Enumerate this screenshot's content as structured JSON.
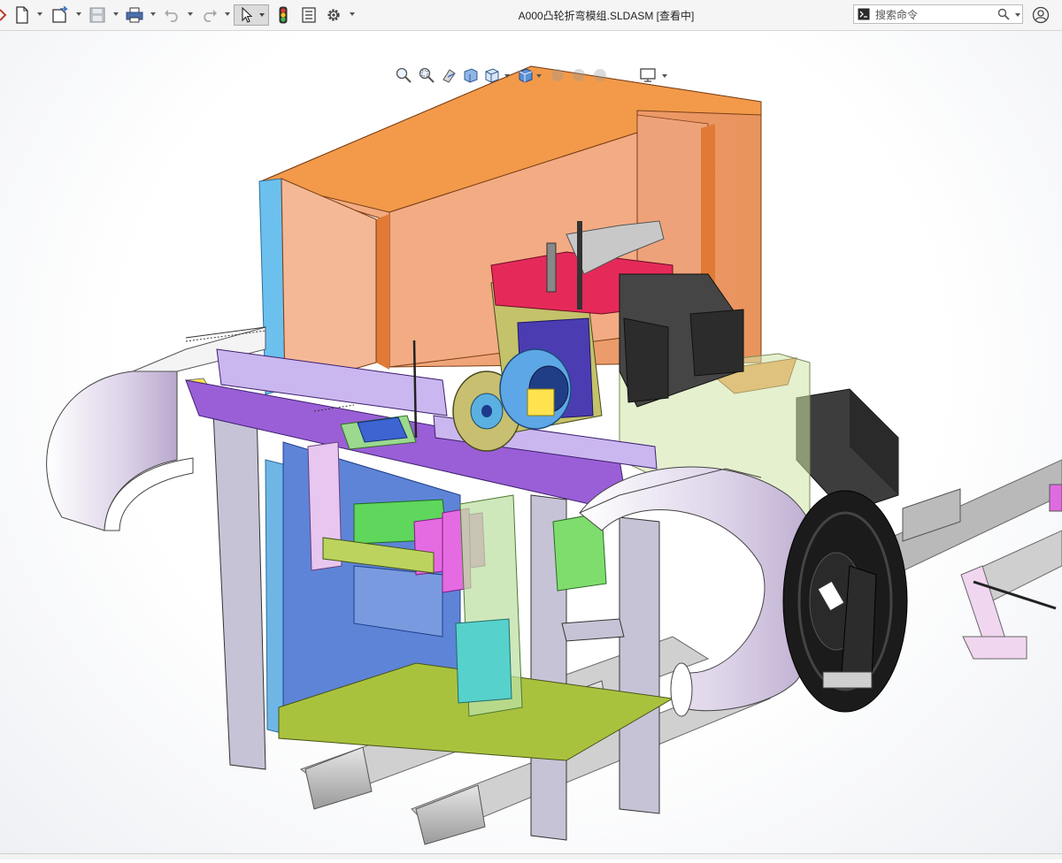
{
  "window": {
    "title": "A000凸轮折弯模组.SLDASM [查看中]"
  },
  "toolbar": {
    "items": [
      {
        "name": "solidworks-menu-icon"
      },
      {
        "name": "new-document-icon"
      },
      {
        "name": "open-document-icon"
      },
      {
        "name": "save-icon"
      },
      {
        "name": "print-icon"
      },
      {
        "name": "undo-icon"
      },
      {
        "name": "redo-icon"
      },
      {
        "name": "select-pointer-icon"
      },
      {
        "name": "rebuild-traffic-light-icon"
      },
      {
        "name": "file-properties-icon"
      },
      {
        "name": "options-gear-icon"
      }
    ]
  },
  "search": {
    "placeholder": "搜索命令"
  },
  "heads_up_toolbar": {
    "items": [
      "zoom-to-fit-icon",
      "zoom-to-area-icon",
      "previous-view-icon",
      "section-view-icon",
      "view-orientation-icon",
      "display-style-icon",
      "hide-show-items-icon",
      "edit-appearance-icon",
      "apply-scene-icon",
      "view-settings-icon"
    ]
  },
  "colors": {
    "accent_orange": "#f29a4a",
    "frame_purple": "#9a8fb8",
    "plate_green": "#a9c23e",
    "magenta": "#e56be3",
    "blue_plate": "#5e84d8"
  }
}
